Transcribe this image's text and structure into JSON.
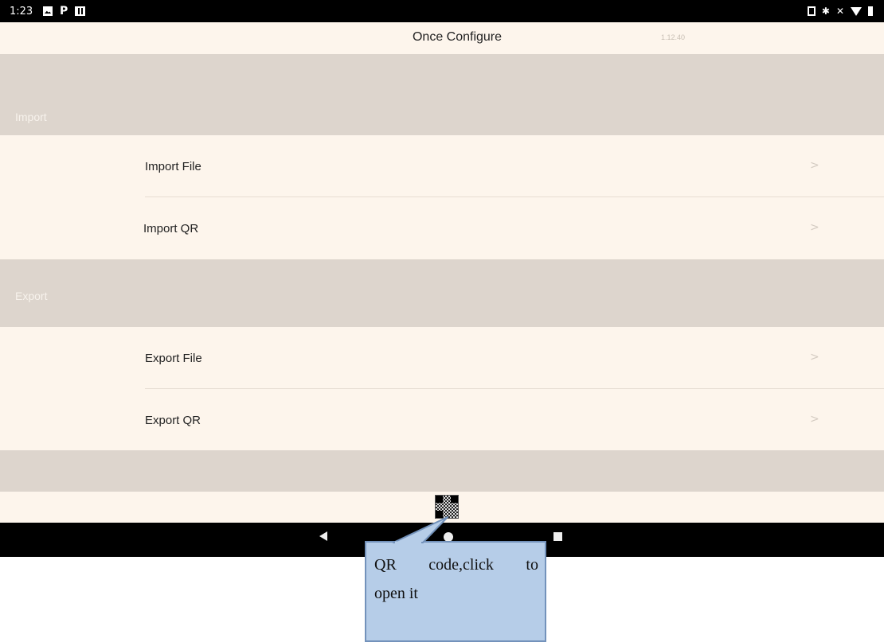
{
  "status_bar": {
    "time": "1:23",
    "left_icons": [
      "photo-icon",
      "p-icon",
      "sim-icon"
    ],
    "right_icons": [
      "phone-icon",
      "bluetooth-icon",
      "mute-icon",
      "wifi-icon",
      "battery-icon"
    ],
    "bluetooth_glyph": "✱",
    "mute_glyph": "✕",
    "p_glyph": "P"
  },
  "header": {
    "title": "Once Configure",
    "version": "1.12.40"
  },
  "sections": [
    {
      "label": "Import",
      "items": [
        {
          "label": "Import File",
          "icon": "chevron-right-icon"
        },
        {
          "label": "Import QR",
          "icon": "chevron-right-icon"
        }
      ]
    },
    {
      "label": "Export",
      "items": [
        {
          "label": "Export File",
          "icon": "chevron-right-icon"
        },
        {
          "label": "Export QR",
          "icon": "chevron-right-icon"
        }
      ]
    }
  ],
  "chevron_glyph": ">",
  "qr_icon": "qr-code-icon",
  "nav_bar": {
    "icons": [
      "back-icon",
      "home-icon",
      "recents-icon"
    ]
  },
  "callout": {
    "line1": "QR code,click to",
    "line2": "open it",
    "fill": "#b6cde8",
    "border": "#7392bb"
  },
  "colors": {
    "background": "#fdf5ec",
    "section_header": "#ddd5cd",
    "status_bar": "#000000"
  }
}
